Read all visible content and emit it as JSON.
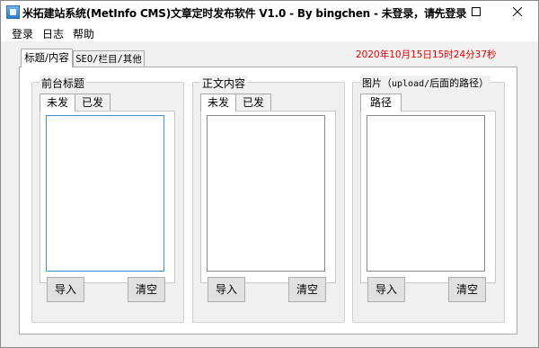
{
  "window": {
    "title": "米拓建站系统(MetInfo CMS)文章定时发布软件 V1.0 - By bingchen - 未登录，请先登录"
  },
  "menu": [
    "登录",
    "日志",
    "帮助"
  ],
  "top_tabs": [
    "标题/内容",
    "SEO/栏目/其他"
  ],
  "datetime": "2020年10月15日15时24分37秒",
  "groups": {
    "front_title": {
      "label": "前台标题",
      "tabs": [
        "未发",
        "已发"
      ],
      "import": "导入",
      "clear": "清空"
    },
    "body": {
      "label": "正文内容",
      "tabs": [
        "未发",
        "已发"
      ],
      "import": "导入",
      "clear": "清空"
    },
    "image": {
      "label_prefix": "图片（",
      "label_mono": "upload/",
      "label_suffix": "后面的路径）",
      "tabs": [
        "路径"
      ],
      "import": "导入",
      "clear": "清空"
    }
  },
  "colors": {
    "datetime": "#e00000",
    "focus_border": "#3c8ed8"
  }
}
